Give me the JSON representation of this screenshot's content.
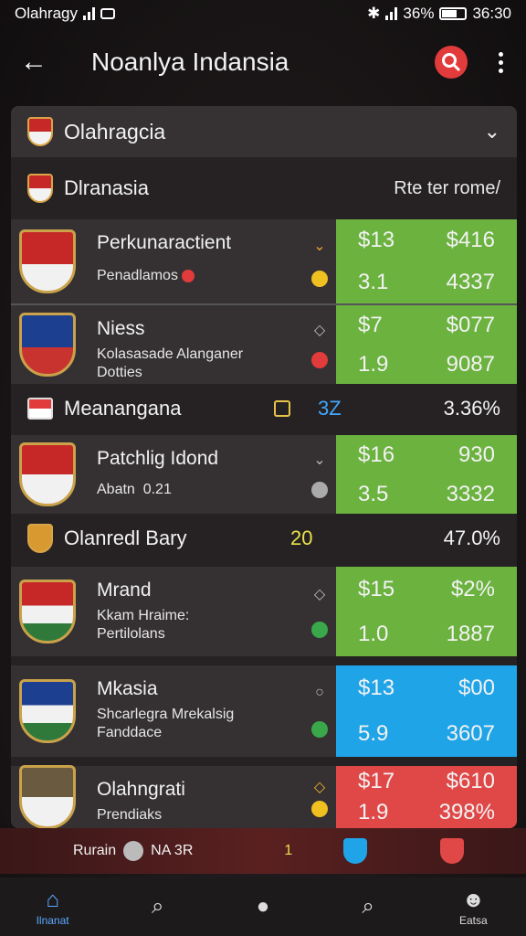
{
  "status": {
    "left_text": "Olahragy",
    "battery_pct": "36%",
    "time": "36:30"
  },
  "app": {
    "title": "Noanlya Indansia",
    "back": "←",
    "menu": "⋮"
  },
  "colors": {
    "green": "#6bb23f",
    "blue": "#1fa4e8",
    "red": "#e04848",
    "panel": "#262223",
    "accent_gold": "#e8c34a"
  },
  "header": {
    "label": "Olahragcia",
    "chevron": "⌄"
  },
  "league": {
    "label": "Dlranasia",
    "right_text": "Rte ter rome/"
  },
  "matches_top": [
    {
      "name": "Perkunaractient",
      "sub1": "Penadlamos",
      "sub2": "",
      "mid_top": "⌄",
      "odds": [
        "$13",
        "$416",
        "3.1",
        "4337"
      ],
      "color": "green"
    },
    {
      "name": "Niess",
      "sub1": "Kolasasade Alanganer",
      "sub2": "Dotties",
      "mid_top": "◇",
      "odds": [
        "$7",
        "$077",
        "1.9",
        "9087"
      ],
      "color": "green"
    }
  ],
  "mid_row_1": {
    "label": "Meanangana",
    "val_a": "3Z",
    "val_b": "3.36%"
  },
  "match_three": {
    "name": "Patchlig Idond",
    "sub1": "Abatn",
    "sub2": "0.21",
    "mid_top": "⌄",
    "odds": [
      "$16",
      "930",
      "3.5",
      "3332"
    ],
    "color": "green"
  },
  "mid_row_2": {
    "label": "Olanredl Bary",
    "val_a": "20",
    "val_b": "47.0%"
  },
  "matches_bottom": [
    {
      "name": "Mrand",
      "sub1": "Kkam Hraime:",
      "sub2": "Pertilolans",
      "mid_top": "◇",
      "odds": [
        "$15",
        "$2%",
        "1.0",
        "1887"
      ],
      "color": "green"
    },
    {
      "name": "Mkasia",
      "sub1": "Shcarlegra Mrekalsig",
      "sub2": "Fanddace",
      "mid_top": "○",
      "odds": [
        "$13",
        "$00",
        "5.9",
        "3607"
      ],
      "color": "blue"
    },
    {
      "name": "Olahngrati",
      "sub1": "Prendiaks",
      "sub2": "",
      "mid_top": "◇",
      "odds": [
        "$17",
        "$610",
        "1.9",
        "398%"
      ],
      "color": "red"
    }
  ],
  "bottom_strip": {
    "text": "Rurain",
    "text2": "NA 3R",
    "count": "1"
  },
  "nav": [
    {
      "label": "Ilnanat",
      "icon": "home-icon",
      "glyph": "⌂"
    },
    {
      "label": "",
      "icon": "search-icon",
      "glyph": "⌕"
    },
    {
      "label": "",
      "icon": "chat-icon",
      "glyph": "●"
    },
    {
      "label": "",
      "icon": "search-icon",
      "glyph": "⌕"
    },
    {
      "label": "Eatsa",
      "icon": "profile-icon",
      "glyph": "☻"
    }
  ]
}
